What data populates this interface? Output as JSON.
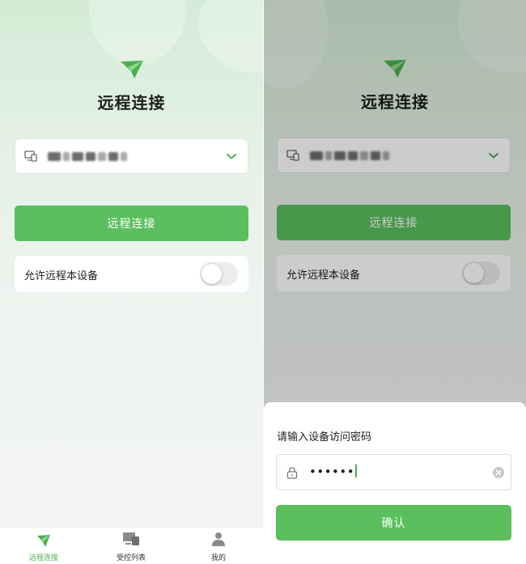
{
  "left": {
    "title": "远程连接",
    "device_select": {
      "value_blurred": "••• ••• •••",
      "icon": "devices-icon",
      "chevron": "chevron-down-icon"
    },
    "connect_button": "远程连接",
    "allow_row": {
      "label": "允许远程本设备",
      "toggle_on": false
    },
    "tabbar": [
      {
        "label": "远程连接",
        "icon": "paper-plane-icon",
        "active": true
      },
      {
        "label": "受控列表",
        "icon": "devices-icon",
        "active": false
      },
      {
        "label": "我的",
        "icon": "user-icon",
        "active": false
      }
    ]
  },
  "right": {
    "title": "远程连接",
    "connect_button": "远程连接",
    "allow_row": {
      "label": "允许远程本设备",
      "toggle_on": false
    },
    "sheet": {
      "title": "请输入设备访问密码",
      "password_masked": "••••••",
      "confirm_button": "确认"
    }
  },
  "colors": {
    "accent": "#5bbf5e",
    "accent_text": "#4cb050",
    "background_top": "#d3ecd5",
    "background_bottom": "#f3f5f4"
  }
}
